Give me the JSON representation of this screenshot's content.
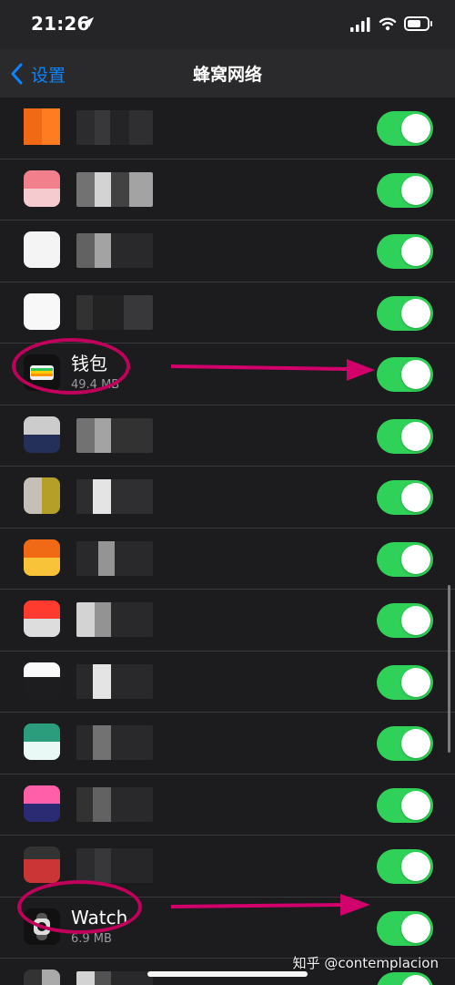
{
  "status": {
    "time": "21:26"
  },
  "nav": {
    "back_label": "设置",
    "title": "蜂窝网络"
  },
  "apps": [
    {
      "name": "",
      "size": "",
      "enabled": true
    },
    {
      "name": "",
      "size": "",
      "enabled": true
    },
    {
      "name": "",
      "size": "",
      "enabled": true
    },
    {
      "name": "",
      "size": "",
      "enabled": true
    },
    {
      "name": "钱包",
      "size": "49.4 MB",
      "enabled": true
    },
    {
      "name": "",
      "size": "",
      "enabled": true
    },
    {
      "name": "",
      "size": "",
      "enabled": true
    },
    {
      "name": "",
      "size": "",
      "enabled": true
    },
    {
      "name": "",
      "size": "",
      "enabled": true
    },
    {
      "name": "",
      "size": "",
      "enabled": true
    },
    {
      "name": "",
      "size": "",
      "enabled": true
    },
    {
      "name": "",
      "size": "",
      "enabled": true
    },
    {
      "name": "",
      "size": "",
      "enabled": true
    },
    {
      "name": "Watch",
      "size": "6.9 MB",
      "enabled": true
    },
    {
      "name": "",
      "size": "",
      "enabled": true
    }
  ],
  "watermark": "知乎 @contemplacion",
  "colors": {
    "accent_blue": "#0a84ff",
    "toggle_on": "#30d158",
    "annotation": "#c0005a"
  },
  "icons": {
    "location": "location-arrow-icon",
    "signal": "signal-bars-icon",
    "wifi": "wifi-icon",
    "battery": "battery-icon",
    "back": "chevron-left-icon",
    "wallet": "wallet-icon",
    "watch": "watch-icon"
  }
}
